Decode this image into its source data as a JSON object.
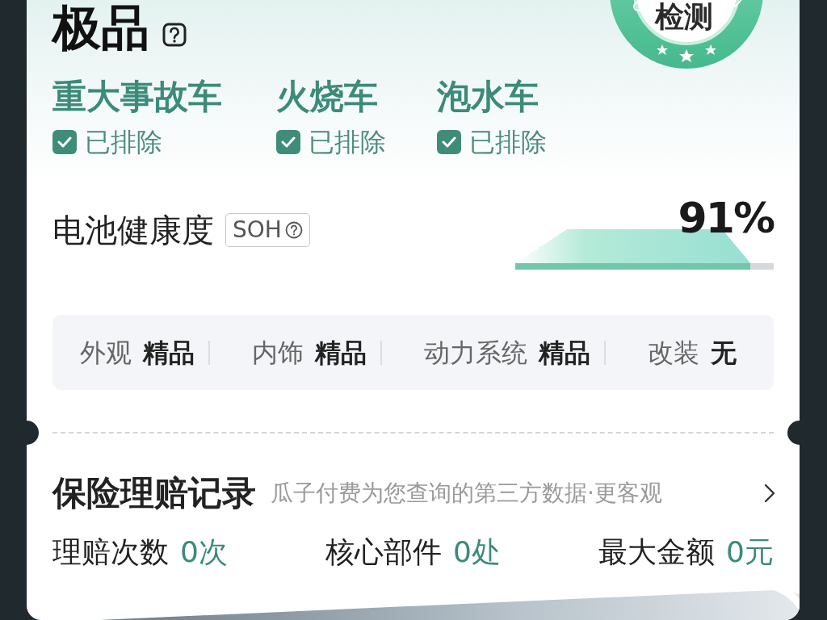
{
  "header": {
    "title": "极品",
    "badge": "检测"
  },
  "exclusions": [
    {
      "label": "重大事故车",
      "status": "已排除",
      "checked": true
    },
    {
      "label": "火烧车",
      "status": "已排除",
      "checked": true
    },
    {
      "label": "泡水车",
      "status": "已排除",
      "checked": true
    }
  ],
  "battery_health": {
    "label": "电池健康度",
    "tag": "SOH",
    "value": "91%",
    "level": 0.91
  },
  "ratings": [
    {
      "label": "外观",
      "value": "精品"
    },
    {
      "label": "内饰",
      "value": "精品"
    },
    {
      "label": "动力系统",
      "value": "精品"
    },
    {
      "label": "改装",
      "value": "无"
    }
  ],
  "insurance": {
    "title": "保险理赔记录",
    "subtitle": "瓜子付费为您查询的第三方数据·更客观",
    "stats": [
      {
        "label": "理赔次数",
        "value": "0次"
      },
      {
        "label": "核心部件",
        "value": "0处"
      },
      {
        "label": "最大金额",
        "value": "0元"
      }
    ]
  }
}
